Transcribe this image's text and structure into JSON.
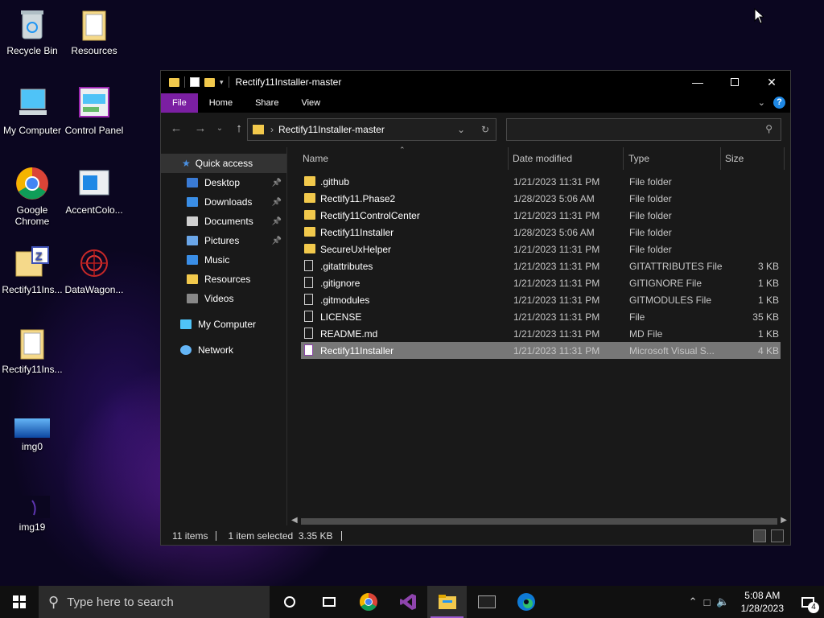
{
  "desktop": {
    "icons": [
      {
        "label": "Recycle Bin"
      },
      {
        "label": "Resources"
      },
      {
        "label": "My Computer"
      },
      {
        "label": "Control Panel"
      },
      {
        "label": "Google Chrome"
      },
      {
        "label": "AccentColo..."
      },
      {
        "label": "Rectify11Ins..."
      },
      {
        "label": "DataWagon..."
      },
      {
        "label": "Rectify11Ins..."
      },
      {
        "label": "img0"
      },
      {
        "label": "img19"
      }
    ]
  },
  "window": {
    "title": "Rectify11Installer-master",
    "ribbon_tabs": [
      "File",
      "Home",
      "Share",
      "View"
    ],
    "help_label": "?",
    "address_path": "Rectify11Installer-master",
    "search_placeholder": "",
    "nav": {
      "quick_access": "Quick access",
      "items": [
        {
          "label": "Desktop",
          "pinned": true,
          "icon": "desktop-icon",
          "color": "#3a7bd5"
        },
        {
          "label": "Downloads",
          "pinned": true,
          "icon": "download-icon",
          "color": "#3a8ee6"
        },
        {
          "label": "Documents",
          "pinned": true,
          "icon": "document-icon",
          "color": "#d0d0d0"
        },
        {
          "label": "Pictures",
          "pinned": true,
          "icon": "picture-icon",
          "color": "#6aa6e8"
        },
        {
          "label": "Music",
          "pinned": false,
          "icon": "music-icon",
          "color": "#3a8ee6"
        },
        {
          "label": "Resources",
          "pinned": false,
          "icon": "folder-icon",
          "color": "#f2c94c"
        },
        {
          "label": "Videos",
          "pinned": false,
          "icon": "video-icon",
          "color": "#888888"
        }
      ],
      "my_computer": "My Computer",
      "network": "Network"
    },
    "columns": {
      "name": "Name",
      "date": "Date modified",
      "type": "Type",
      "size": "Size"
    },
    "files": [
      {
        "name": ".github",
        "date": "1/21/2023 11:31 PM",
        "type": "File folder",
        "size": "",
        "kind": "folder"
      },
      {
        "name": "Rectify11.Phase2",
        "date": "1/28/2023 5:06 AM",
        "type": "File folder",
        "size": "",
        "kind": "folder"
      },
      {
        "name": "Rectify11ControlCenter",
        "date": "1/21/2023 11:31 PM",
        "type": "File folder",
        "size": "",
        "kind": "folder"
      },
      {
        "name": "Rectify11Installer",
        "date": "1/28/2023 5:06 AM",
        "type": "File folder",
        "size": "",
        "kind": "folder"
      },
      {
        "name": "SecureUxHelper",
        "date": "1/21/2023 11:31 PM",
        "type": "File folder",
        "size": "",
        "kind": "folder"
      },
      {
        "name": ".gitattributes",
        "date": "1/21/2023 11:31 PM",
        "type": "GITATTRIBUTES File",
        "size": "3 KB",
        "kind": "file"
      },
      {
        "name": ".gitignore",
        "date": "1/21/2023 11:31 PM",
        "type": "GITIGNORE File",
        "size": "1 KB",
        "kind": "file"
      },
      {
        "name": ".gitmodules",
        "date": "1/21/2023 11:31 PM",
        "type": "GITMODULES File",
        "size": "1 KB",
        "kind": "file"
      },
      {
        "name": "LICENSE",
        "date": "1/21/2023 11:31 PM",
        "type": "File",
        "size": "35 KB",
        "kind": "file"
      },
      {
        "name": "README.md",
        "date": "1/21/2023 11:31 PM",
        "type": "MD File",
        "size": "1 KB",
        "kind": "file"
      },
      {
        "name": "Rectify11Installer",
        "date": "1/21/2023 11:31 PM",
        "type": "Microsoft Visual S...",
        "size": "4 KB",
        "kind": "vs",
        "selected": true
      }
    ],
    "status": {
      "items": "11 items",
      "selected": "1 item selected  3.35 KB"
    }
  },
  "taskbar": {
    "search_placeholder": "Type here to search",
    "time": "5:08 AM",
    "date": "1/28/2023",
    "notification_count": "4"
  },
  "colors": {
    "file_tab": "#7b1fa2",
    "folder": "#f2c94c",
    "selection": "#777777"
  }
}
